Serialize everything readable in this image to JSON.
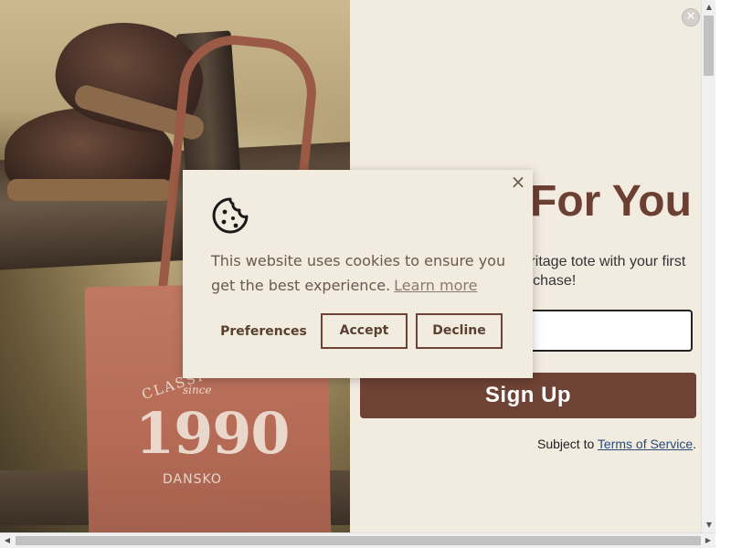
{
  "popup": {
    "close_symbol": "✕",
    "headline": "For You",
    "offer_text": "Heritage tote with your first purchase!",
    "email_placeholder": "",
    "signup_label": "Sign Up",
    "subject_prefix": "Subject to ",
    "terms_link": "Terms of Service",
    "subject_suffix": "."
  },
  "tote": {
    "line1": "CLASSIC SINCE",
    "line2": "since",
    "year": "1990",
    "brand": "DANSKO"
  },
  "cookie_banner": {
    "icon": "cookie-icon",
    "close_symbol": "×",
    "message": "This website uses cookies to ensure you get the best experience.",
    "learn_more": "Learn more",
    "preferences_label": "Preferences",
    "accept_label": "Accept",
    "decline_label": "Decline"
  },
  "scrollbars": {
    "up_arrow": "▲",
    "down_arrow": "▼",
    "left_arrow": "◀",
    "right_arrow": "▶"
  },
  "colors": {
    "panel_bg": "#f2ebe0",
    "brand_brown": "#6e4234",
    "cookie_text": "#6b5a4a"
  }
}
